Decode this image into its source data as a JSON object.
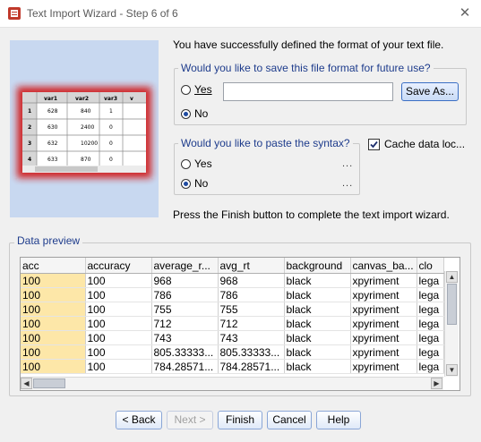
{
  "window": {
    "title": "Text Import Wizard - Step 6 of 6"
  },
  "message": "You have successfully defined the format of your text file.",
  "save_format": {
    "question": "Would you like to save this file format for future use?",
    "yes_label": "Yes",
    "no_label": "No",
    "selected": "No",
    "save_as_label": "Save As...",
    "path_value": ""
  },
  "paste_syntax": {
    "question": "Would you like to paste the syntax?",
    "yes_label": "Yes",
    "no_label": "No",
    "selected": "No",
    "ellipsis": "..."
  },
  "cache": {
    "label": "Cache data loc...",
    "checked": true
  },
  "finish_hint": "Press the Finish button to complete the text import wizard.",
  "preview": {
    "legend": "Data preview",
    "columns": [
      "acc",
      "accuracy",
      "average_r...",
      "avg_rt",
      "background",
      "canvas_ba...",
      "clo"
    ],
    "rows": [
      [
        "100",
        "100",
        "968",
        "968",
        "black",
        "xpyriment",
        "lega"
      ],
      [
        "100",
        "100",
        "786",
        "786",
        "black",
        "xpyriment",
        "lega"
      ],
      [
        "100",
        "100",
        "755",
        "755",
        "black",
        "xpyriment",
        "lega"
      ],
      [
        "100",
        "100",
        "712",
        "712",
        "black",
        "xpyriment",
        "lega"
      ],
      [
        "100",
        "100",
        "743",
        "743",
        "black",
        "xpyriment",
        "lega"
      ],
      [
        "100",
        "100",
        "805.33333...",
        "805.33333...",
        "black",
        "xpyriment",
        "lega"
      ],
      [
        "100",
        "100",
        "784.28571...",
        "784.28571...",
        "black",
        "xpyriment",
        "lega"
      ]
    ]
  },
  "thumbnail": {
    "headers": [
      "var1",
      "var2",
      "var3",
      "v"
    ],
    "rows": [
      [
        "1",
        "628",
        "840",
        "1"
      ],
      [
        "2",
        "630",
        "2400",
        "0"
      ],
      [
        "3",
        "632",
        "10200",
        "0"
      ],
      [
        "4",
        "633",
        "870",
        "0"
      ]
    ]
  },
  "footer": {
    "back": "< Back",
    "next": "Next >",
    "finish": "Finish",
    "cancel": "Cancel",
    "help": "Help"
  },
  "colors": {
    "accent": "#1e3c8c",
    "first_col": "#fde7a8",
    "glow": "#d11a1a"
  }
}
